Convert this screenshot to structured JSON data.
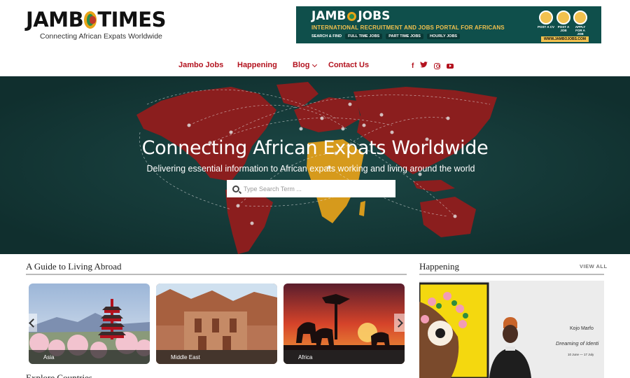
{
  "header": {
    "logo_text_left": "JAMB",
    "logo_text_right": "TIMES",
    "tagline": "Connecting African Expats Worldwide"
  },
  "banner": {
    "title_left": "JAMB",
    "title_right": "JOBS",
    "subtitle": "INTERNATIONAL RECRUITMENT AND JOBS PORTAL FOR AFRICANS",
    "search_label": "SEARCH & FIND",
    "pills": [
      "FULL TIME JOBS",
      "PART TIME JOBS",
      "HOURLY JOBS"
    ],
    "qr_labels": [
      "POST A CV",
      "POST A JOB",
      "APPLY FOR A JOB"
    ],
    "url": "WWW.JAMBOJOBS.COM"
  },
  "nav": {
    "items": [
      {
        "label": "Jambo Jobs"
      },
      {
        "label": "Happening"
      },
      {
        "label": "Blog"
      },
      {
        "label": "Contact Us"
      }
    ],
    "social": [
      "facebook-icon",
      "twitter-icon",
      "instagram-icon",
      "youtube-icon"
    ]
  },
  "hero": {
    "title": "Connecting African Expats Worldwide",
    "subtitle": "Delivering essential information to African expats working and living around the world",
    "search_placeholder": "Type Search Term ..."
  },
  "guide": {
    "title": "A Guide to Living Abroad",
    "cards": [
      {
        "label": "Asia"
      },
      {
        "label": "Middle East"
      },
      {
        "label": "Africa"
      }
    ]
  },
  "happening": {
    "title": "Happening",
    "view_all": "VIEW ALL",
    "exhibit_name": "Kojo Marfo",
    "exhibit_title": "Dreaming of Identi",
    "exhibit_dates": "10 June — 17 July"
  },
  "explore": {
    "title": "Explore Countries"
  },
  "colors": {
    "brand_red": "#b3121e",
    "hero_bg": "#143a39",
    "map_red": "#8b1e1e",
    "map_africa": "#d69a1c"
  }
}
